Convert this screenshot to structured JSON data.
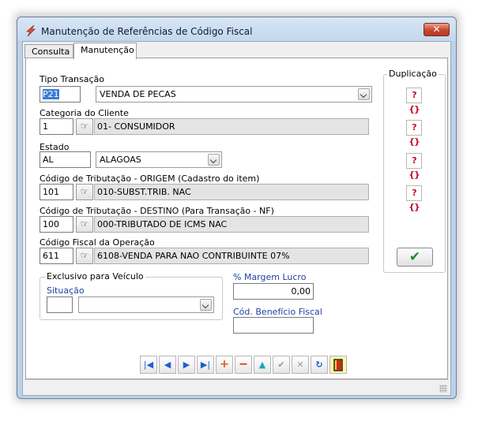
{
  "window": {
    "title": "Manutenção de Referências de Código Fiscal",
    "close_label": "✕"
  },
  "tabs": [
    {
      "label": "Consulta"
    },
    {
      "label": "Manutenção"
    }
  ],
  "tipo_transacao": {
    "label": "Tipo Transação",
    "code": "P21",
    "value": "VENDA DE PECAS"
  },
  "categoria": {
    "label": "Categoria do Cliente",
    "code": "1",
    "description": "01- CONSUMIDOR"
  },
  "estado": {
    "label": "Estado",
    "code": "AL",
    "value": "ALAGOAS"
  },
  "trib_origem": {
    "label": "Código de Tributação - ORIGEM (Cadastro do item)",
    "code": "101",
    "description": "010-SUBST.TRIB. NAC"
  },
  "trib_destino": {
    "label": "Código de Tributação - DESTINO (Para Transação - NF)",
    "code": "100",
    "description": "000-TRIBUTADO DE ICMS NAC"
  },
  "cfop": {
    "label": "Código Fiscal da Operação",
    "code": "611",
    "description": "6108-VENDA PARA NAO CONTRIBUINTE 07%"
  },
  "veiculo": {
    "group_title": "Exclusivo para Veículo",
    "situacao_label": "Situação",
    "situacao_code": "",
    "situacao_value": ""
  },
  "margem": {
    "label": "% Margem Lucro",
    "value": "0,00"
  },
  "beneficio": {
    "label": "Cód. Benefício Fiscal",
    "value": ""
  },
  "duplicacao": {
    "title": "Duplicação",
    "button_label": "?{}",
    "confirm_label": "✔"
  },
  "navigator": {
    "first": "|◀",
    "prior": "◀",
    "next": "▶",
    "last": "▶|",
    "insert": "+",
    "delete": "−",
    "edit": "▲",
    "post": "✔",
    "cancel": "✕",
    "refresh": "↻",
    "exit": "▮"
  },
  "icons": {
    "lookup": "pointing-hand-icon",
    "app": "lightning-icon"
  }
}
